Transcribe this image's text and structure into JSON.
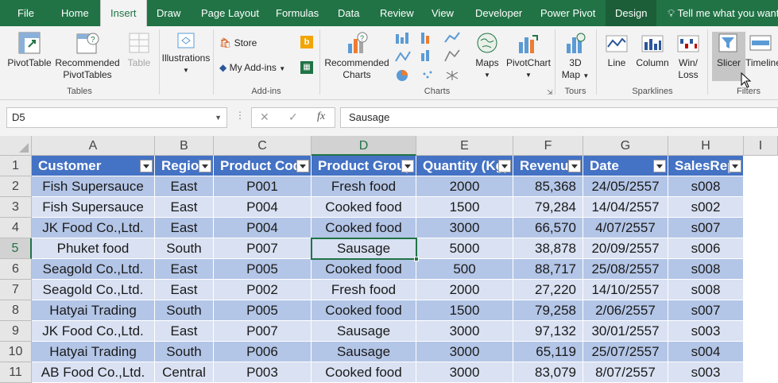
{
  "tabs": [
    {
      "label": "File"
    },
    {
      "label": "Home"
    },
    {
      "label": "Insert"
    },
    {
      "label": "Draw"
    },
    {
      "label": "Page Layout"
    },
    {
      "label": "Formulas"
    },
    {
      "label": "Data"
    },
    {
      "label": "Review"
    },
    {
      "label": "View"
    },
    {
      "label": "Developer"
    },
    {
      "label": "Power Pivot"
    },
    {
      "label": "Design"
    }
  ],
  "tell_me": "Tell me what you want",
  "ribbon": {
    "tables": {
      "group": "Tables",
      "pivottable": "PivotTable",
      "recommended_pivot_1": "Recommended",
      "recommended_pivot_2": "PivotTables",
      "table": "Table"
    },
    "illustrations": {
      "label": "Illustrations"
    },
    "addins": {
      "group": "Add-ins",
      "store": "Store",
      "my_addins": "My Add-ins"
    },
    "charts": {
      "group": "Charts",
      "recommended_1": "Recommended",
      "recommended_2": "Charts",
      "maps": "Maps",
      "pivotchart": "PivotChart"
    },
    "tours": {
      "group": "Tours",
      "map_1": "3D",
      "map_2": "Map"
    },
    "sparklines": {
      "group": "Sparklines",
      "line": "Line",
      "column": "Column",
      "winloss_1": "Win/",
      "winloss_2": "Loss"
    },
    "filters": {
      "group": "Filters",
      "slicer": "Slicer",
      "timeline": "Timeline"
    }
  },
  "formula_bar": {
    "name_box": "D5",
    "cancel": "✕",
    "enter": "✓",
    "fx": "fx",
    "content": "Sausage"
  },
  "columns": [
    "A",
    "B",
    "C",
    "D",
    "E",
    "F",
    "G",
    "H",
    "I"
  ],
  "rows": [
    "1",
    "2",
    "3",
    "4",
    "5",
    "6",
    "7",
    "8",
    "9",
    "10",
    "11"
  ],
  "table": {
    "headers": [
      "Customer",
      "Region",
      "Product Code",
      "Product Group",
      "Quantity (Kg)",
      "Revenue",
      "Date",
      "SalesRep"
    ],
    "data": [
      [
        "Fish Supersauce",
        "East",
        "P001",
        "Fresh food",
        "2000",
        "85,368",
        "24/05/2557",
        "s008"
      ],
      [
        "Fish Supersauce",
        "East",
        "P004",
        "Cooked food",
        "1500",
        "79,284",
        "14/04/2557",
        "s002"
      ],
      [
        "JK Food Co.,Ltd.",
        "East",
        "P004",
        "Cooked food",
        "3000",
        "66,570",
        "4/07/2557",
        "s007"
      ],
      [
        "Phuket food",
        "South",
        "P007",
        "Sausage",
        "5000",
        "38,878",
        "20/09/2557",
        "s006"
      ],
      [
        "Seagold Co.,Ltd.",
        "East",
        "P005",
        "Cooked food",
        "500",
        "88,717",
        "25/08/2557",
        "s008"
      ],
      [
        "Seagold Co.,Ltd.",
        "East",
        "P002",
        "Fresh food",
        "2000",
        "27,220",
        "14/10/2557",
        "s008"
      ],
      [
        "Hatyai Trading",
        "South",
        "P005",
        "Cooked food",
        "1500",
        "79,258",
        "2/06/2557",
        "s007"
      ],
      [
        "JK Food Co.,Ltd.",
        "East",
        "P007",
        "Sausage",
        "3000",
        "97,132",
        "30/01/2557",
        "s003"
      ],
      [
        "Hatyai Trading",
        "South",
        "P006",
        "Sausage",
        "3000",
        "65,119",
        "25/07/2557",
        "s004"
      ],
      [
        "AB Food Co.,Ltd.",
        "Central",
        "P003",
        "Cooked food",
        "3000",
        "83,079",
        "8/07/2557",
        "s003"
      ]
    ]
  },
  "colors": {
    "ribbon_green": "#217346",
    "table_header": "#4472c4",
    "band_dark": "#b4c6e7",
    "band_light": "#d9e1f2"
  }
}
